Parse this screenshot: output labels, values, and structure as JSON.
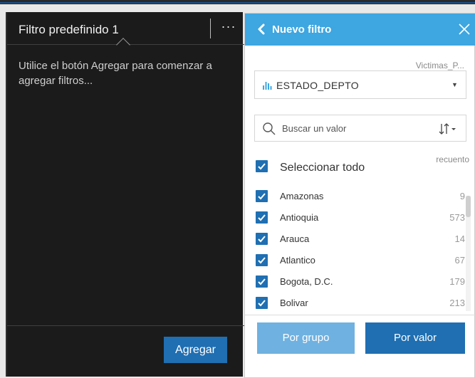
{
  "left_panel": {
    "title": "Filtro predefinido 1",
    "more_label": "···",
    "message": "Utilice el botón Agregar para comenzar a agregar filtros...",
    "add_button": "Agregar"
  },
  "right_panel": {
    "title": "Nuevo filtro",
    "dataset": "Victimas_P...",
    "field": "ESTADO_DEPTO",
    "search_placeholder": "Buscar un valor",
    "count_header": "recuento",
    "select_all_label": "Seleccionar todo",
    "items": [
      {
        "label": "Amazonas",
        "count": "9"
      },
      {
        "label": "Antioquia",
        "count": "573"
      },
      {
        "label": "Arauca",
        "count": "14"
      },
      {
        "label": "Atlantico",
        "count": "67"
      },
      {
        "label": "Bogota, D.C.",
        "count": "179"
      },
      {
        "label": "Bolivar",
        "count": "213"
      }
    ],
    "group_button": "Por grupo",
    "value_button": "Por valor"
  },
  "colors": {
    "header_blue": "#3ea6e0",
    "button_blue": "#1f6fb2",
    "button_light_blue": "#6fb1e0",
    "dark_panel": "#1b1b1b"
  },
  "icons": {
    "back": "chevron-left-icon",
    "close": "close-icon",
    "field": "bar-chart-icon",
    "search": "search-icon",
    "sort": "sort-icon",
    "checkbox": "checkbox-checked-icon"
  }
}
